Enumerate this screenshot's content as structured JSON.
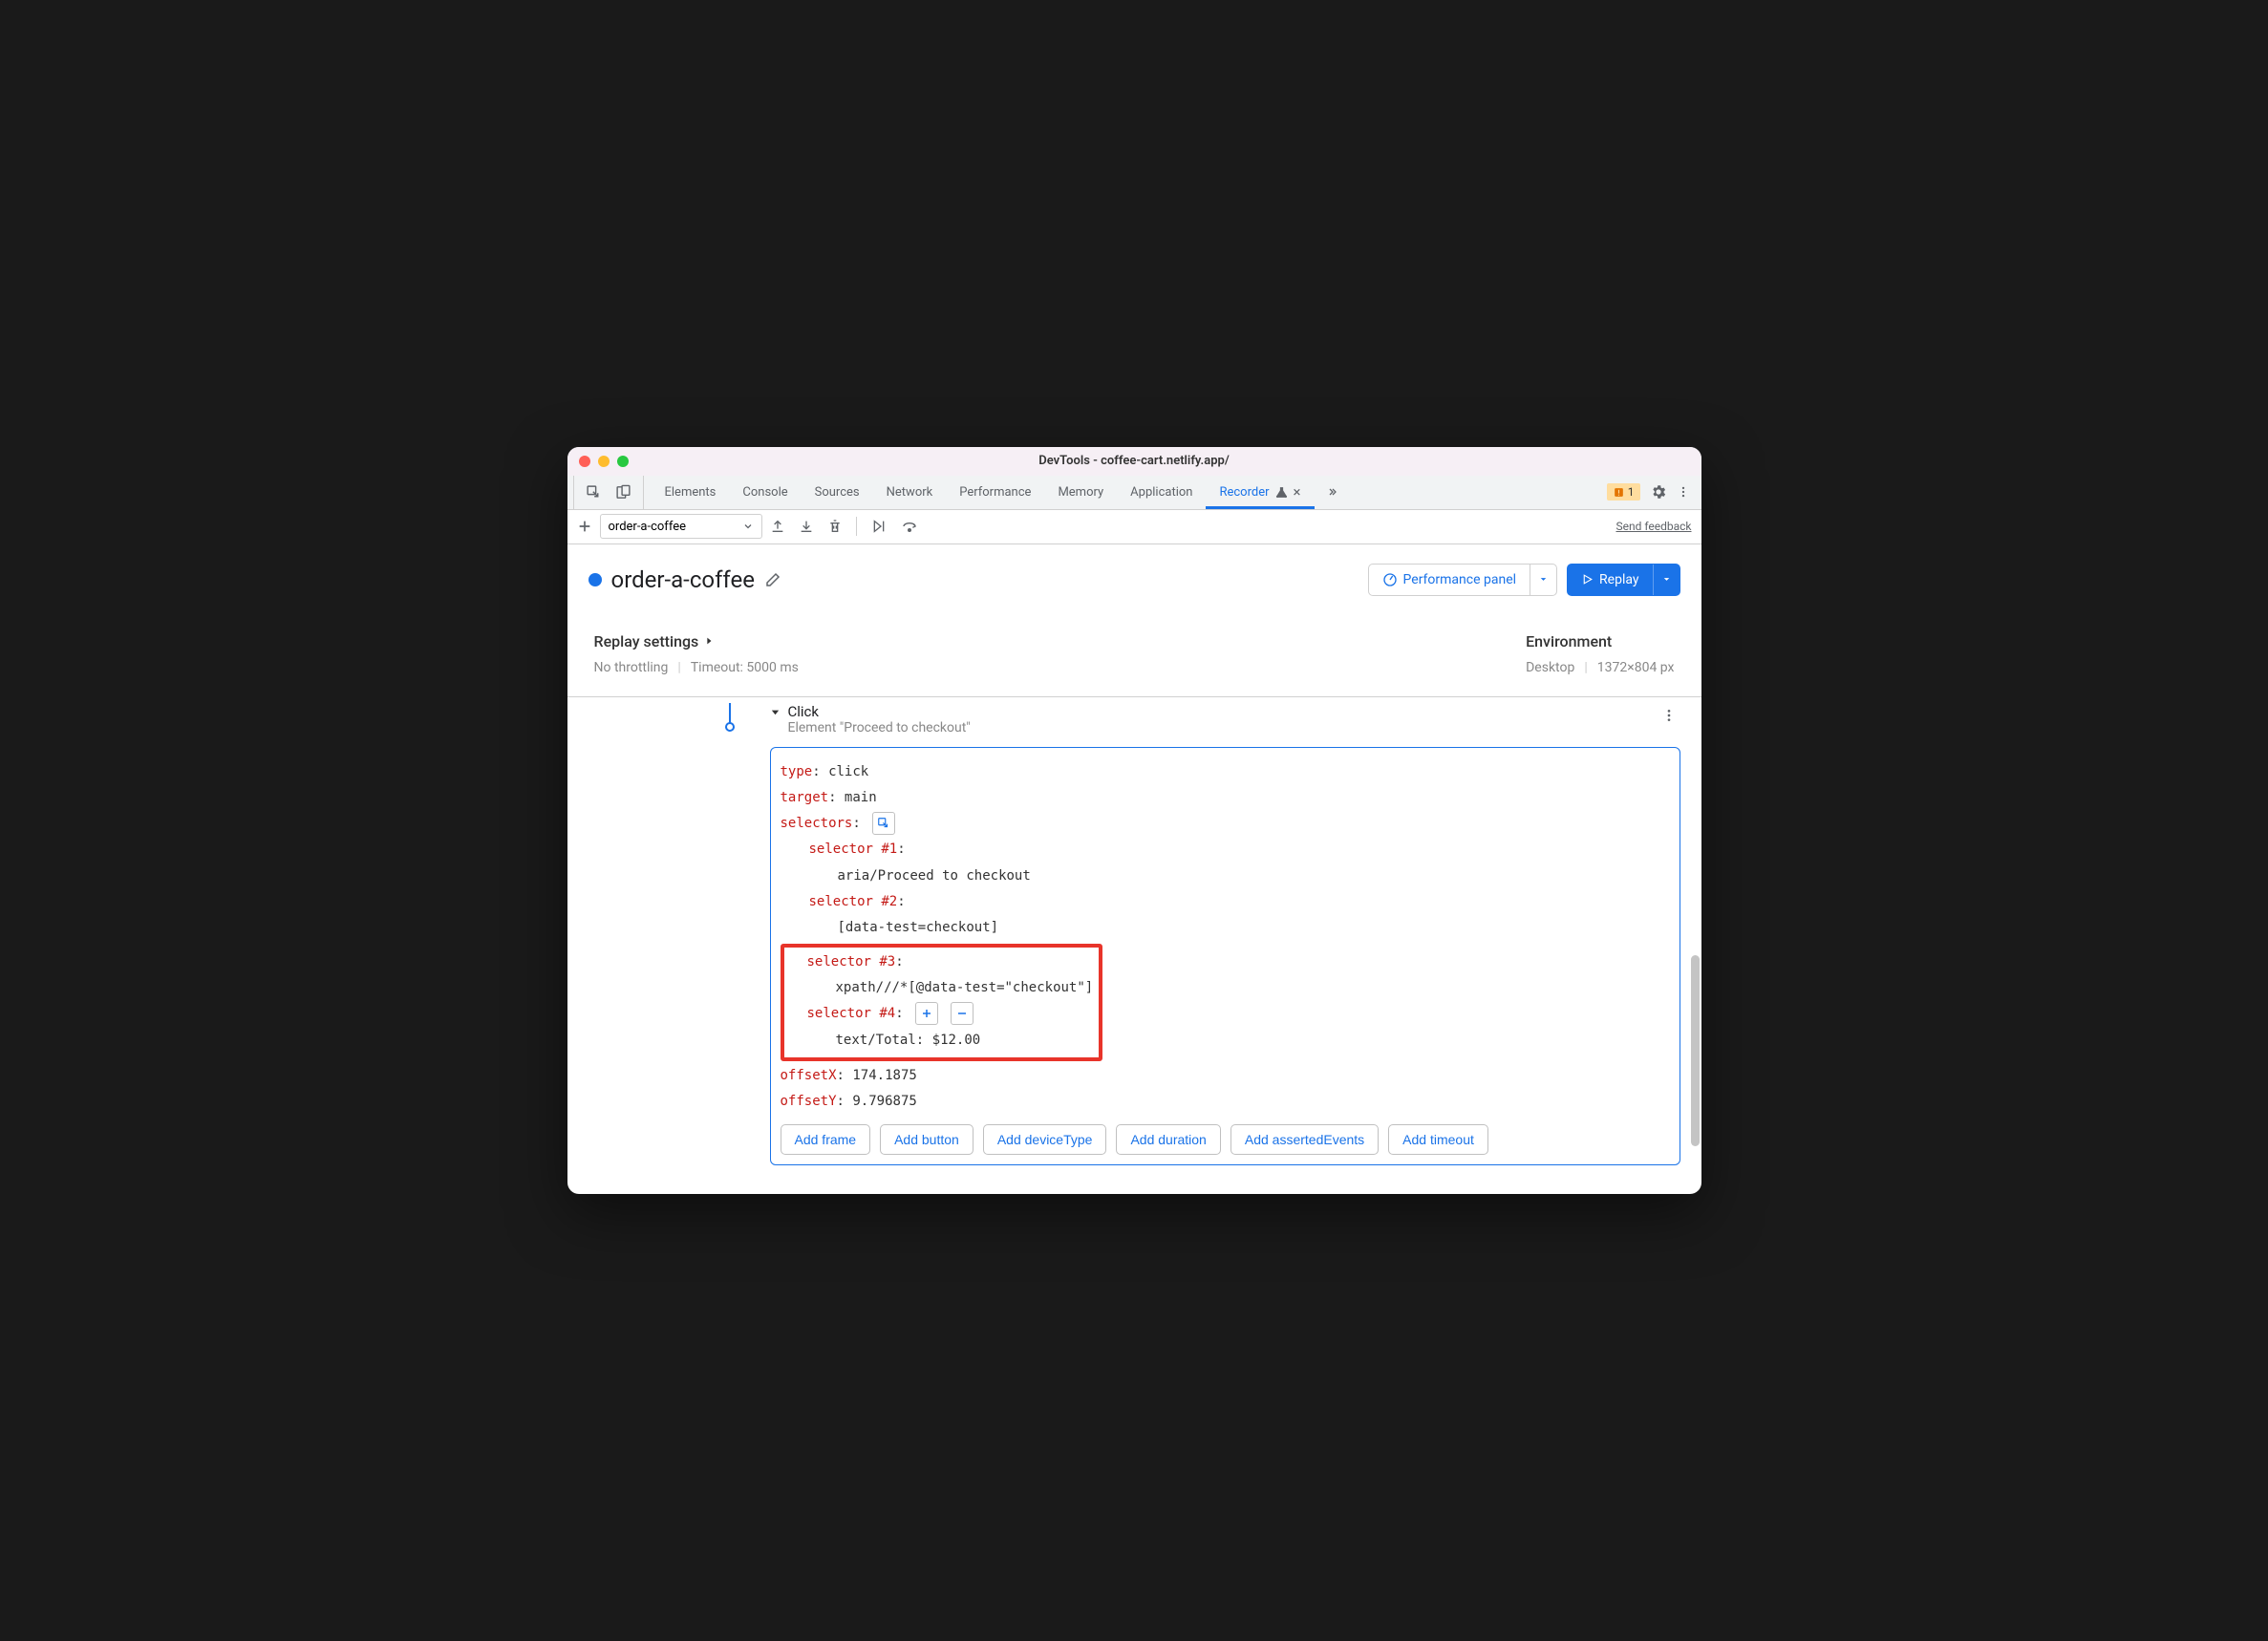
{
  "window": {
    "title": "DevTools - coffee-cart.netlify.app/"
  },
  "tabs": {
    "items": [
      "Elements",
      "Console",
      "Sources",
      "Network",
      "Performance",
      "Memory",
      "Application",
      "Recorder"
    ],
    "active": "Recorder",
    "warning_count": "1"
  },
  "toolbar": {
    "recording_select": "order-a-coffee",
    "feedback_label": "Send feedback"
  },
  "header": {
    "title": "order-a-coffee",
    "perf_panel_label": "Performance panel",
    "replay_label": "Replay"
  },
  "settings": {
    "replay_title": "Replay settings",
    "throttling": "No throttling",
    "timeout": "Timeout: 5000 ms",
    "env_title": "Environment",
    "env_device": "Desktop",
    "env_dims": "1372×804 px"
  },
  "step": {
    "title": "Click",
    "subtitle": "Element \"Proceed to checkout\"",
    "kv": {
      "type_k": "type",
      "type_v": ": click",
      "target_k": "target",
      "target_v": ": main",
      "selectors_k": "selectors",
      "selectors_v": ":",
      "sel1_k": "selector #1",
      "sel1_c": ":",
      "sel1_v": "aria/Proceed to checkout",
      "sel2_k": "selector #2",
      "sel2_c": ":",
      "sel2_v": "[data-test=checkout]",
      "sel3_k": "selector #3",
      "sel3_c": ":",
      "sel3_v": "xpath///*[@data-test=\"checkout\"]",
      "sel4_k": "selector #4",
      "sel4_c": ":",
      "sel4_v": "text/Total: $12.00",
      "ox_k": "offsetX",
      "ox_v": ": 174.1875",
      "oy_k": "offsetY",
      "oy_v": ": 9.796875"
    },
    "add_buttons": [
      "Add frame",
      "Add button",
      "Add deviceType",
      "Add duration",
      "Add assertedEvents",
      "Add timeout"
    ]
  }
}
